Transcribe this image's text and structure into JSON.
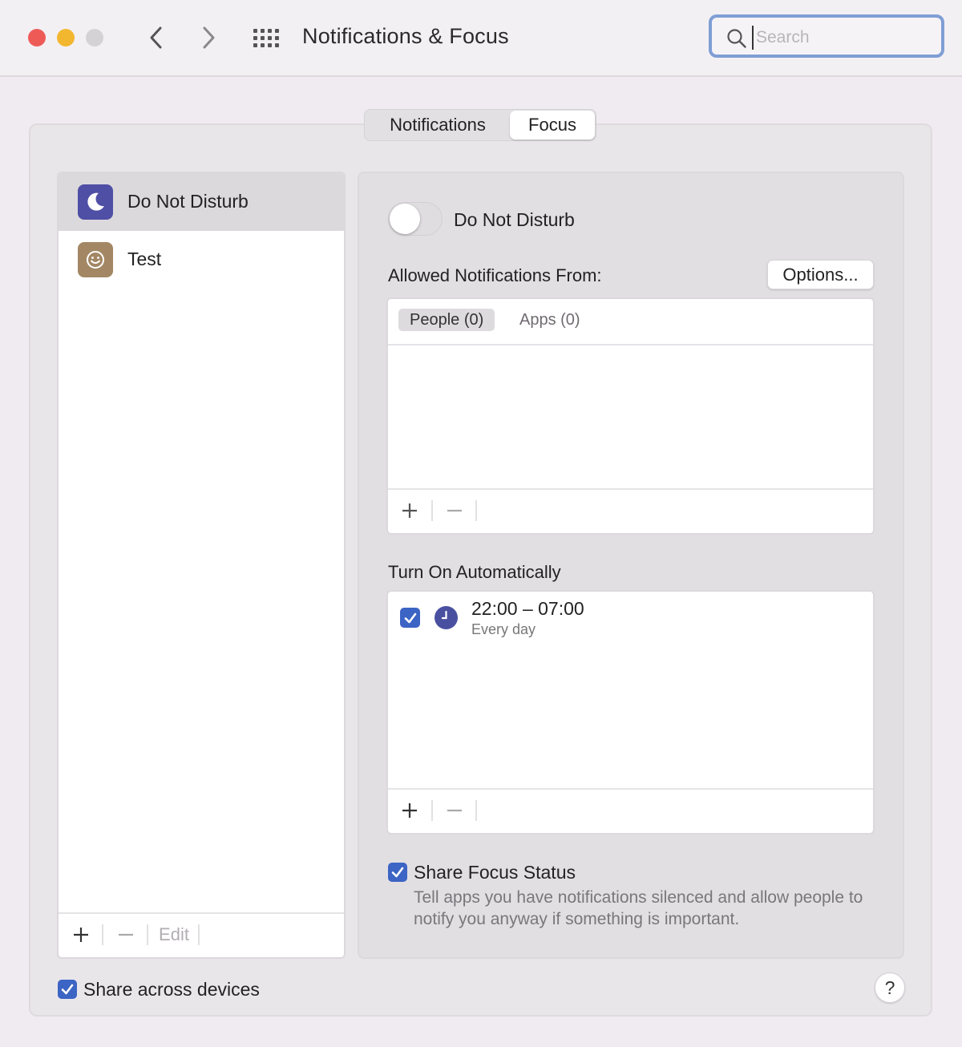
{
  "window": {
    "title": "Notifications & Focus"
  },
  "search": {
    "placeholder": "Search",
    "value": ""
  },
  "tabs": {
    "notifications": "Notifications",
    "focus": "Focus"
  },
  "focus_list": {
    "items": [
      {
        "label": "Do Not Disturb",
        "icon": "moon-icon",
        "selected": true
      },
      {
        "label": "Test",
        "icon": "smiley-icon",
        "selected": false
      }
    ],
    "edit_label": "Edit"
  },
  "detail": {
    "toggle_label": "Do Not Disturb",
    "toggle_on": false,
    "allowed_heading": "Allowed Notifications From:",
    "options_label": "Options...",
    "people_tab": "People (0)",
    "apps_tab": "Apps (0)",
    "turn_on_heading": "Turn On Automatically",
    "schedule": {
      "time": "22:00 – 07:00",
      "days": "Every day",
      "enabled": true
    },
    "share_status_label": "Share Focus Status",
    "share_status_desc": "Tell apps you have notifications silenced and allow people to notify you anyway if something is important."
  },
  "footer": {
    "share_devices_label": "Share across devices",
    "help_label": "?"
  },
  "colors": {
    "accent": "#3c64c4",
    "dnd_icon_bg": "#4f4fa6",
    "test_icon_bg": "#a38764"
  }
}
